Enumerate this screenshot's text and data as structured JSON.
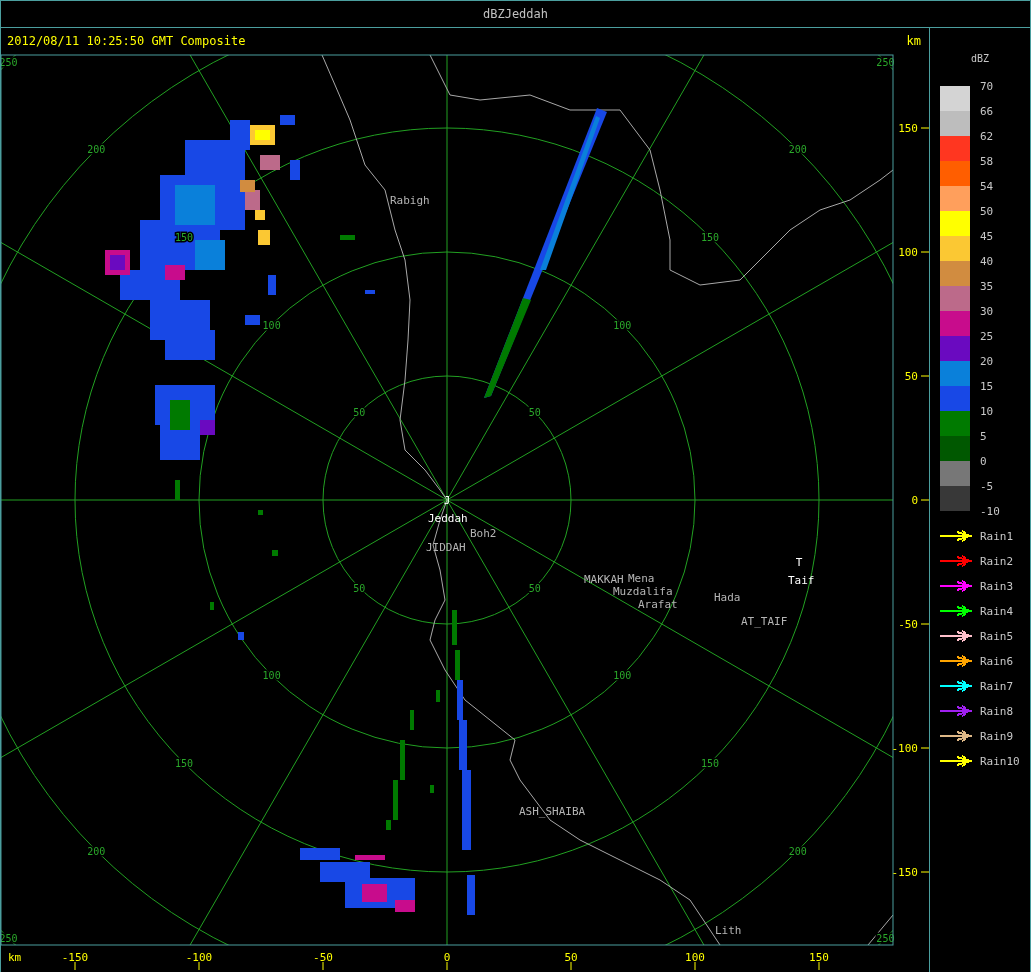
{
  "window": {
    "title": "dBZJeddah"
  },
  "header": {
    "timestamp": "2012/08/11 10:25:50 GMT Composite",
    "unit": "km"
  },
  "map": {
    "range_rings": [
      {
        "labels": [
          "50",
          "50",
          "50",
          "50"
        ]
      },
      {
        "labels": [
          "100",
          "100",
          "100",
          "100"
        ]
      },
      {
        "labels": [
          "150",
          "150",
          "150",
          "150"
        ]
      },
      {
        "labels": [
          "200",
          "200",
          "200",
          "200"
        ]
      },
      {
        "labels": [
          "250",
          "250",
          "250",
          "250"
        ]
      }
    ],
    "places": [
      {
        "kind": "place",
        "label": "Rabigh"
      },
      {
        "kind": "station_marker",
        "label": "J"
      },
      {
        "kind": "station",
        "label": "Jeddah"
      },
      {
        "kind": "place",
        "label": "Boh2"
      },
      {
        "kind": "place",
        "label": "JIDDAH"
      },
      {
        "kind": "place",
        "label": "MAKKAH"
      },
      {
        "kind": "place",
        "label": "Mena"
      },
      {
        "kind": "place",
        "label": "Muzdalifa"
      },
      {
        "kind": "place",
        "label": "Arafat"
      },
      {
        "kind": "station_marker",
        "label": "T"
      },
      {
        "kind": "station",
        "label": "Taif"
      },
      {
        "kind": "place",
        "label": "Hada"
      },
      {
        "kind": "place",
        "label": "AT_TAIF"
      },
      {
        "kind": "place",
        "label": "ASH_SHAIBA"
      },
      {
        "kind": "place",
        "label": "Lith"
      }
    ],
    "y_axis": {
      "ticks": [
        "150",
        "100",
        "50",
        "0",
        "-50",
        "-100",
        "-150"
      ]
    },
    "x_axis": {
      "unit": "km",
      "ticks": [
        "-150",
        "-100",
        "-50",
        "0",
        "50",
        "100",
        "150"
      ]
    }
  },
  "legend": {
    "title": "dBZ",
    "bins": [
      {
        "color": "#d4d4d4"
      },
      {
        "color": "#bdbdbd"
      },
      {
        "color": "#ff3620"
      },
      {
        "color": "#ff5e00"
      },
      {
        "color": "#ff9f5c"
      },
      {
        "color": "#ffff00"
      },
      {
        "color": "#fbc833"
      },
      {
        "color": "#d18c40"
      },
      {
        "color": "#bc6a8a"
      },
      {
        "color": "#c80c8c"
      },
      {
        "color": "#6a0ac0"
      },
      {
        "color": "#0a80da"
      },
      {
        "color": "#1848e6"
      },
      {
        "color": "#007a00"
      },
      {
        "color": "#005800"
      },
      {
        "color": "#777777"
      },
      {
        "color": "#383838"
      }
    ],
    "labels": [
      "70",
      "66",
      "62",
      "58",
      "54",
      "50",
      "45",
      "40",
      "35",
      "30",
      "25",
      "20",
      "15",
      "10",
      "5",
      "0",
      "-5",
      "-10"
    ]
  },
  "rain_tracks": [
    {
      "label": "Rain1",
      "color": "#ffff00"
    },
    {
      "label": "Rain2",
      "color": "#ff0000"
    },
    {
      "label": "Rain3",
      "color": "#ff00ff"
    },
    {
      "label": "Rain4",
      "color": "#00ff00"
    },
    {
      "label": "Rain5",
      "color": "#ffc0cb"
    },
    {
      "label": "Rain6",
      "color": "#ffa500"
    },
    {
      "label": "Rain7",
      "color": "#00ffff"
    },
    {
      "label": "Rain8",
      "color": "#a020f0"
    },
    {
      "label": "Rain9",
      "color": "#deb887"
    },
    {
      "label": "Rain10",
      "color": "#ffff00"
    }
  ]
}
